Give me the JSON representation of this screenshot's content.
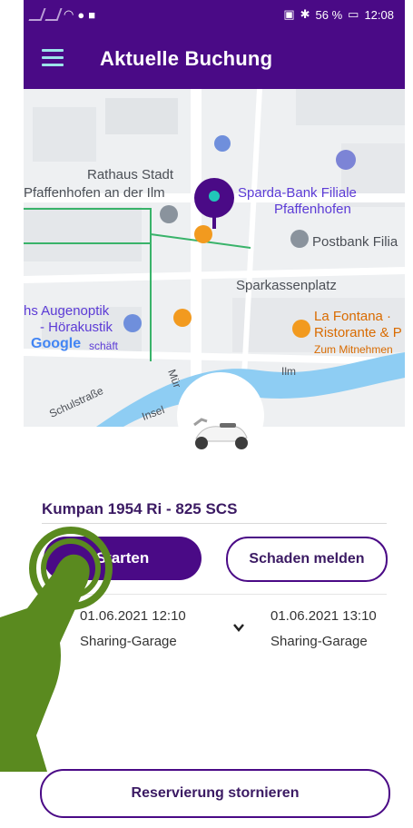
{
  "status_bar": {
    "battery_text": "56 %",
    "time": "12:08"
  },
  "app_bar": {
    "title": "Aktuelle Buchung",
    "menu_icon": "menu-icon"
  },
  "map": {
    "labels": {
      "rathaus": "Rathaus Stadt",
      "rathaus2": "Pfaffenhofen an der Ilm",
      "sparda1": "Sparda-Bank Filiale",
      "sparda2": "Pfaffenhofen",
      "postbank": "Postbank Filia",
      "sparkassen": "Sparkassenplatz",
      "augenoptik1": "hs Augenoptik",
      "augenoptik2": "- Hörakustik",
      "schaeft": "schäft",
      "fontana1": "La Fontana ·",
      "fontana2": "Ristorante & P",
      "fontana3": "Zum Mitnehmen",
      "ilm": "Ilm",
      "mur": "Mür",
      "insel": "Insel",
      "schulstrasse": "Schulstraße"
    },
    "google_logo": "Google"
  },
  "booking": {
    "vehicle_name": "Kumpan 1954 Ri - 825 SCS",
    "start_button": "Starten",
    "damage_button": "Schaden melden",
    "start_datetime": "01.06.2021 12:10",
    "start_location": "Sharing-Garage",
    "end_datetime": "01.06.2021 13:10",
    "end_location": "Sharing-Garage",
    "cancel_button": "Reservierung stornieren"
  },
  "colors": {
    "primary": "#4a0a86",
    "accent": "#9ce4e9",
    "hand": "#5a8a1f"
  }
}
